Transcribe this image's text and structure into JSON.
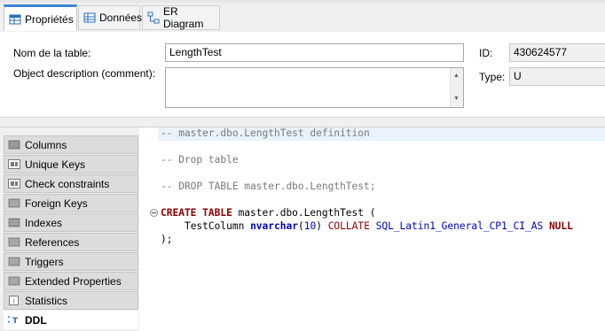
{
  "tabs": [
    {
      "label": "Propriétés",
      "icon": "table-properties-icon",
      "active": true
    },
    {
      "label": "Données",
      "icon": "data-grid-icon",
      "active": false
    },
    {
      "label": "ER Diagram",
      "icon": "er-diagram-icon",
      "active": false
    }
  ],
  "properties": {
    "table_name_label": "Nom de la table:",
    "table_name_value": "LengthTest",
    "description_label": "Object description (comment):",
    "description_value": "",
    "id_label": "ID:",
    "id_value": "430624577",
    "type_label": "Type:",
    "type_value": "U"
  },
  "nav": {
    "items": [
      {
        "label": "Columns",
        "icon": "columns-icon"
      },
      {
        "label": "Unique Keys",
        "icon": "unique-keys-icon"
      },
      {
        "label": "Check constraints",
        "icon": "check-constraints-icon"
      },
      {
        "label": "Foreign Keys",
        "icon": "foreign-keys-icon"
      },
      {
        "label": "Indexes",
        "icon": "indexes-icon"
      },
      {
        "label": "References",
        "icon": "references-icon"
      },
      {
        "label": "Triggers",
        "icon": "triggers-icon"
      },
      {
        "label": "Extended Properties",
        "icon": "extended-properties-icon"
      },
      {
        "label": "Statistics",
        "icon": "statistics-icon"
      },
      {
        "label": "DDL",
        "icon": "ddl-icon",
        "active": true
      }
    ]
  },
  "ddl": {
    "line1": "-- master.dbo.LengthTest definition",
    "line2": "-- Drop table",
    "line3": "-- DROP TABLE master.dbo.LengthTest;",
    "line4_kw": "CREATE TABLE",
    "line4_rest": " master.dbo.LengthTest (",
    "line5_indent": "    ",
    "line5_col": "TestColumn",
    "line5_type": "nvarchar",
    "line5_paren_open": "(",
    "line5_len": "10",
    "line5_paren_close": ")",
    "line5_collate": "COLLATE",
    "line5_collation": "SQL_Latin1_General_CP1_CI_AS",
    "line5_null": "NULL",
    "line6": ");"
  },
  "colors": {
    "accent": "#3c86d4",
    "keyword": "#8b0000",
    "type": "#0000c0",
    "comment": "#7a7a7a"
  }
}
